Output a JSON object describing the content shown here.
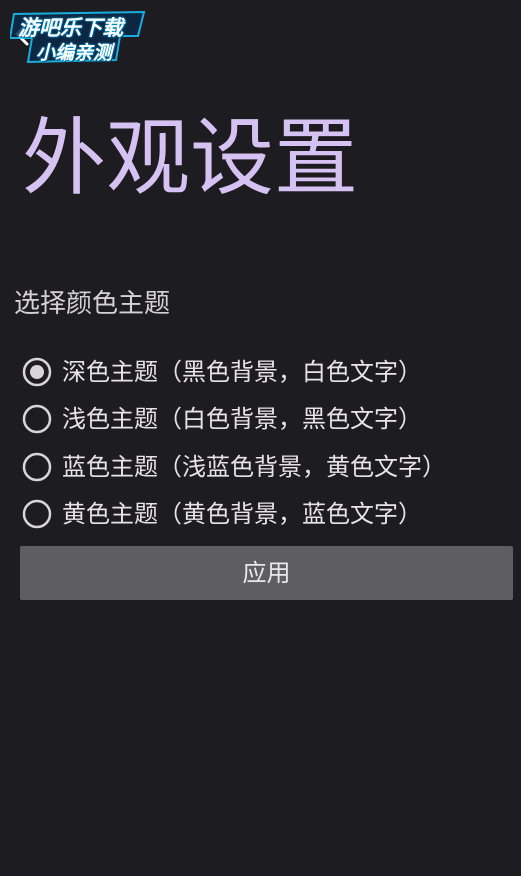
{
  "watermark": {
    "line1": "游吧乐下载",
    "line2": "小编亲测"
  },
  "page": {
    "title": "外观设置",
    "section_label": "选择颜色主题"
  },
  "themes": [
    {
      "label": "深色主题（黑色背景，白色文字）",
      "selected": true
    },
    {
      "label": "浅色主题（白色背景，黑色文字）",
      "selected": false
    },
    {
      "label": "蓝色主题（浅蓝色背景，黄色文字）",
      "selected": false
    },
    {
      "label": "黄色主题（黄色背景，蓝色文字）",
      "selected": false
    }
  ],
  "apply_button": {
    "label": "应用"
  },
  "colors": {
    "background": "#1d1c20",
    "title": "#d6c2f2",
    "button_bg": "#5e5e60",
    "radio_ring": "#d8d6da",
    "text": "#e6e4e8"
  }
}
